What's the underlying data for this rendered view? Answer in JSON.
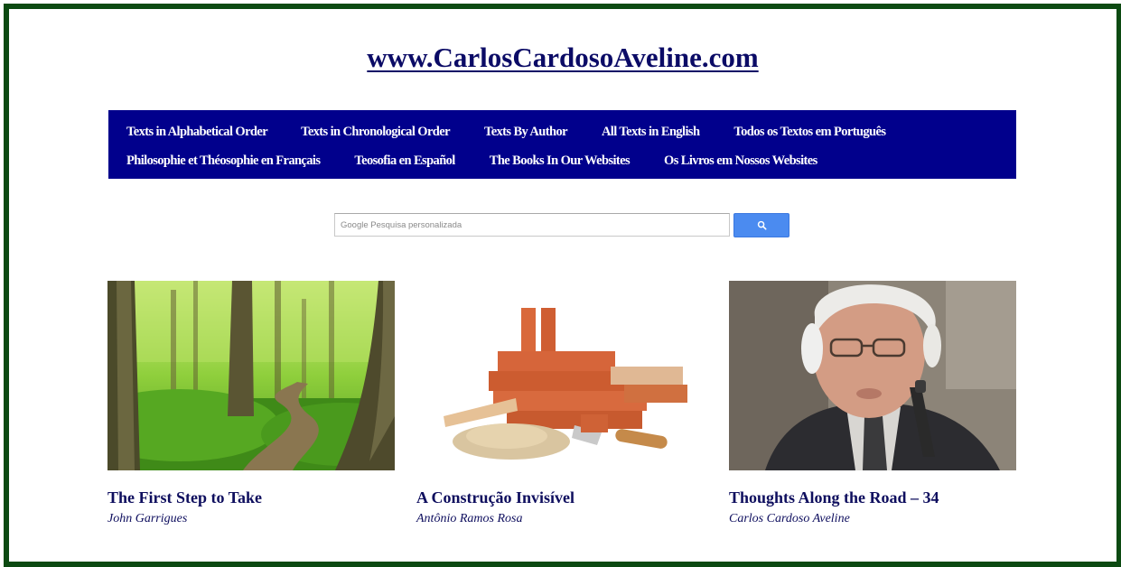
{
  "site": {
    "title": "www.CarlosCardosoAveline.com"
  },
  "nav": {
    "row1": [
      {
        "label": "Texts in Alphabetical Order"
      },
      {
        "label": "Texts in Chronological Order"
      },
      {
        "label": "Texts By Author"
      },
      {
        "label": "All Texts in English"
      },
      {
        "label": "Todos os Textos em Português"
      }
    ],
    "row2": [
      {
        "label": "Philosophie et Théosophie en Français"
      },
      {
        "label": "Teosofia en Español"
      },
      {
        "label": "The Books In Our Websites"
      },
      {
        "label": "Os Livros em Nossos Websites"
      }
    ]
  },
  "search": {
    "placeholder": "Google Pesquisa personalizada",
    "button_icon": "search-icon"
  },
  "articles": [
    {
      "title": "The First Step to Take",
      "author": "John Garrigues",
      "image": "forest-path-image"
    },
    {
      "title": "A Construção Invisível",
      "author": "Antônio Ramos Rosa",
      "image": "bricks-and-trowel-image"
    },
    {
      "title": "Thoughts Along the Road – 34",
      "author": "Carlos Cardoso Aveline",
      "image": "elderly-man-with-pipe-image"
    }
  ],
  "colors": {
    "frame": "#0c4a12",
    "nav_background": "#01008c",
    "title_text": "#0b0b66",
    "search_button": "#4b8bf0"
  }
}
